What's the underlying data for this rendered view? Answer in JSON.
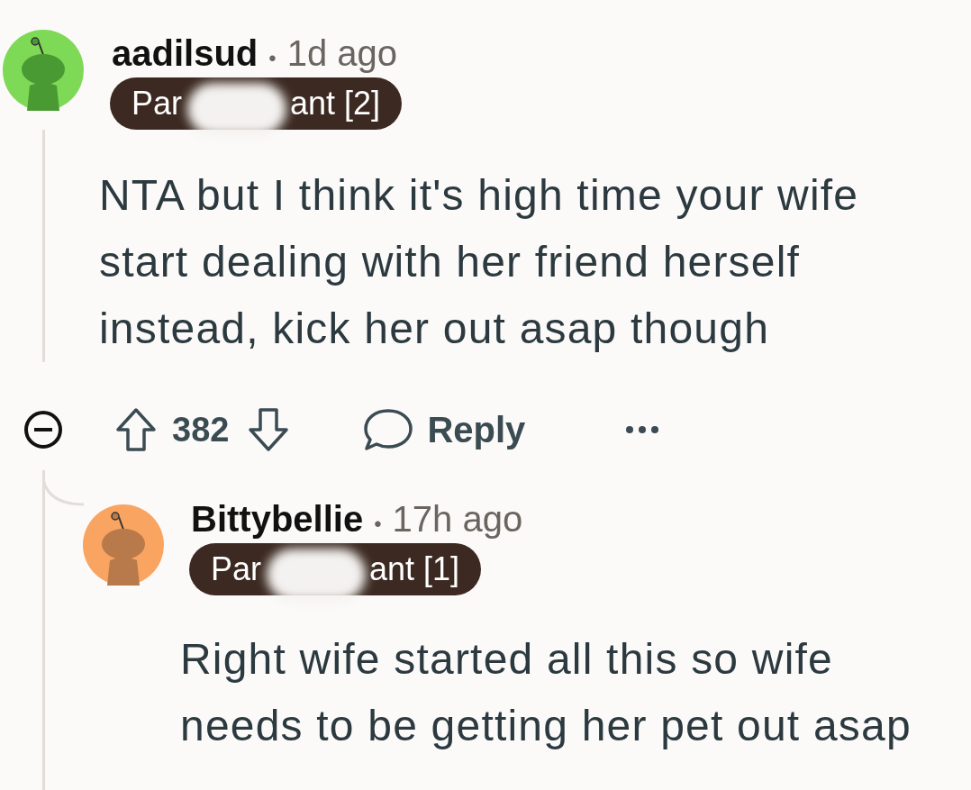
{
  "comments": [
    {
      "author": "aadilsud",
      "separator": "•",
      "time": "1d ago",
      "flair": [
        "Par",
        "ant [2]"
      ],
      "body": "NTA but I think it's high time your wife start dealing with her friend herself instead, kick her out asap though",
      "votes": "382",
      "reply_label": "Reply",
      "children": [
        {
          "author": "Bittybellie",
          "separator": "•",
          "time": "17h ago",
          "flair": [
            "Par",
            "ant [1]"
          ],
          "body": "Right wife started all this so wife needs to be getting her pet out asap"
        }
      ]
    }
  ]
}
